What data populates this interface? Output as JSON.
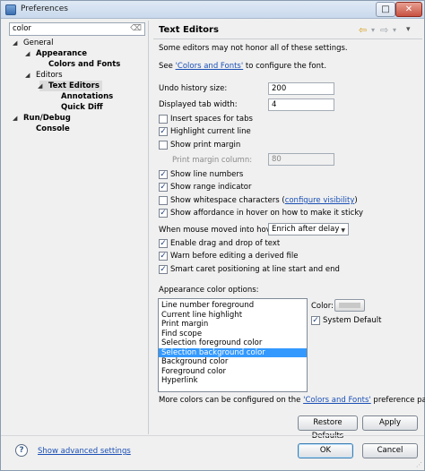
{
  "window": {
    "title": "Preferences",
    "maximize_glyph": "□",
    "close_glyph": "✕"
  },
  "filter": {
    "value": "color",
    "clear_glyph": "⌫"
  },
  "tree": [
    {
      "label": "General",
      "twisty": "◢",
      "bold": false
    },
    {
      "label": "Appearance",
      "twisty": "◢",
      "bold": true
    },
    {
      "label": "Colors and Fonts",
      "twisty": "",
      "bold": true
    },
    {
      "label": "Editors",
      "twisty": "◢",
      "bold": false
    },
    {
      "label": "Text Editors",
      "twisty": "◢",
      "bold": true
    },
    {
      "label": "Annotations",
      "twisty": "",
      "bold": true
    },
    {
      "label": "Quick Diff",
      "twisty": "",
      "bold": true
    },
    {
      "label": "Run/Debug",
      "twisty": "◢",
      "bold": true
    },
    {
      "label": "Console",
      "twisty": "",
      "bold": true
    }
  ],
  "page": {
    "title": "Text Editors",
    "nav_back": "⇦",
    "nav_back_menu": "▾",
    "nav_fwd": "⇨",
    "nav_fwd_menu": "▾",
    "nav_menu": "▾",
    "intro": "Some editors may not honor all of these settings.",
    "see_prefix": "See ",
    "see_link": "'Colors and Fonts'",
    "see_suffix": " to configure the font.",
    "undo_label": "Undo history size:",
    "undo_value": "200",
    "tab_label": "Displayed tab width:",
    "tab_value": "4",
    "print_margin_label": "Print margin column:",
    "print_margin_value": "80",
    "hover_label": "When mouse moved into hover:",
    "hover_value": "Enrich after delay",
    "appearance_label": "Appearance color options:",
    "color_label": "Color:",
    "system_default": "System Default",
    "footer_prefix": "More colors can be configured on the ",
    "footer_link": "'Colors and Fonts'",
    "footer_suffix": " preference page.",
    "whitespace_link": "configure visibility",
    "whitespace_close": ")"
  },
  "checks_a": [
    {
      "label": "Insert spaces for tabs",
      "checked": false
    },
    {
      "label": "Highlight current line",
      "checked": true
    },
    {
      "label": "Show print margin",
      "checked": false
    }
  ],
  "checks_b": [
    {
      "label": "Show line numbers",
      "checked": true
    },
    {
      "label": "Show range indicator",
      "checked": true
    },
    {
      "label": "Show whitespace characters (",
      "checked": false
    },
    {
      "label": "Show affordance in hover on how to make it sticky",
      "checked": true
    }
  ],
  "checks_c": [
    {
      "label": "Enable drag and drop of text",
      "checked": true
    },
    {
      "label": "Warn before editing a derived file",
      "checked": true
    },
    {
      "label": "Smart caret positioning at line start and end",
      "checked": true
    }
  ],
  "color_options": [
    "Line number foreground",
    "Current line highlight",
    "Print margin",
    "Find scope",
    "Selection foreground color",
    "Selection background color",
    "Background color",
    "Foreground color",
    "Hyperlink"
  ],
  "selected_color_index": 5,
  "system_default_checked": true,
  "buttons": {
    "restore": "Restore Defaults",
    "apply": "Apply",
    "ok": "OK",
    "cancel": "Cancel"
  },
  "help": {
    "glyph": "?",
    "advanced_link": "Show advanced settings"
  },
  "check_glyph": "✓",
  "colors": {
    "selection": "#3399ff",
    "link": "#1a4fb5"
  }
}
